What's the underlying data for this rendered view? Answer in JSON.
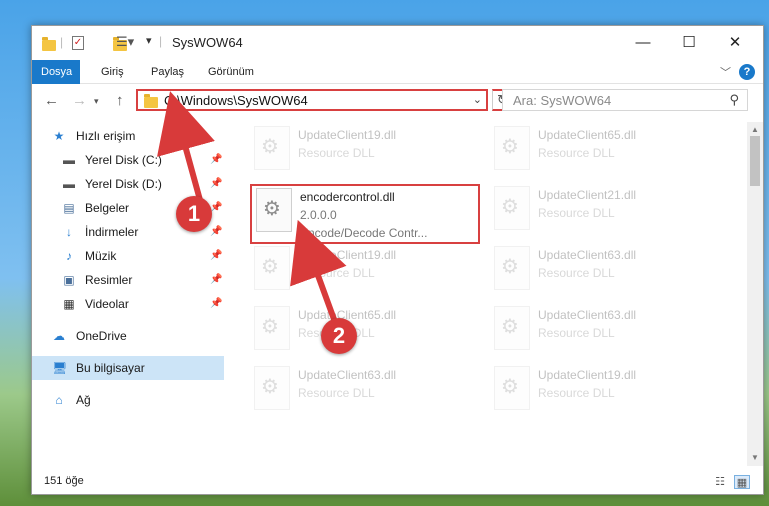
{
  "window": {
    "title": "SysWOW64"
  },
  "ribbon": {
    "tabs": [
      {
        "label": "Dosya",
        "active": true
      },
      {
        "label": "Giriş",
        "active": false
      },
      {
        "label": "Paylaş",
        "active": false
      },
      {
        "label": "Görünüm",
        "active": false
      }
    ],
    "help_label": "?"
  },
  "nav": {
    "address": "C:\\Windows\\SysWOW64",
    "search_placeholder": "Ara: SysWOW64"
  },
  "sidebar": {
    "items": [
      {
        "label": "Hızlı erişim",
        "icon": "star-icon",
        "pinned": false
      },
      {
        "label": "Yerel Disk (C:)",
        "icon": "drive-icon",
        "pinned": true
      },
      {
        "label": "Yerel Disk (D:)",
        "icon": "drive-icon",
        "pinned": true
      },
      {
        "label": "Belgeler",
        "icon": "documents-icon",
        "pinned": true
      },
      {
        "label": "İndirmeler",
        "icon": "download-icon",
        "pinned": true
      },
      {
        "label": "Müzik",
        "icon": "music-icon",
        "pinned": true
      },
      {
        "label": "Resimler",
        "icon": "pictures-icon",
        "pinned": true
      },
      {
        "label": "Videolar",
        "icon": "video-icon",
        "pinned": true
      },
      {
        "label": "OneDrive",
        "icon": "cloud-icon",
        "pinned": false
      },
      {
        "label": "Bu bilgisayar",
        "icon": "computer-icon",
        "pinned": false,
        "selected": true
      },
      {
        "label": "Ağ",
        "icon": "network-icon",
        "pinned": false
      }
    ]
  },
  "files": {
    "highlighted": {
      "name": "encodercontrol.dll",
      "version": "2.0.0.0",
      "description": "Encode/Decode Contr..."
    },
    "background": [
      {
        "name": "UpdateClient19.dll",
        "type": "Resource DLL"
      },
      {
        "name": "UpdateClient65.dll",
        "type": "Resource DLL"
      },
      {
        "name": "UpdateClient21.dll",
        "type": "Resource DLL"
      },
      {
        "name": "UpdateClient19.dll",
        "type": "Resource DLL"
      },
      {
        "name": "UpdateClient63.dll",
        "type": "Resource DLL"
      },
      {
        "name": "UpdateClient65.dll",
        "type": "Resource DLL"
      },
      {
        "name": "UpdateClient63.dll",
        "type": "Resource DLL"
      },
      {
        "name": "UpdateClient63.dll",
        "type": "Resource DLL"
      },
      {
        "name": "UpdateClient19.dll",
        "type": "Resource DLL"
      }
    ]
  },
  "status": {
    "item_count": "151 öğe"
  },
  "annotations": {
    "step1": "1",
    "step2": "2"
  },
  "colors": {
    "accent": "#1979ca",
    "highlight": "#d84040"
  }
}
